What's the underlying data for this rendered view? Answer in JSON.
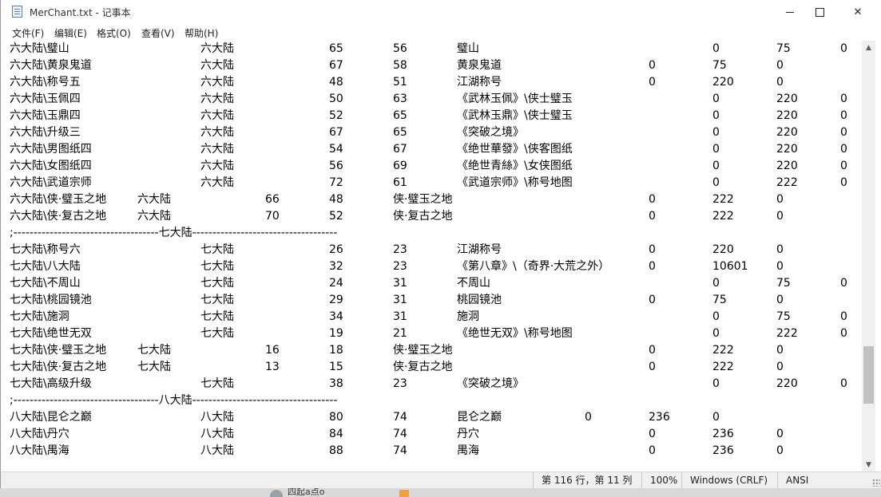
{
  "window": {
    "title": "MerChant.txt - 记事本",
    "icon": "notepad-icon",
    "controls": {
      "minimize": "minimize-icon",
      "maximize": "maximize-icon",
      "close": "✕"
    }
  },
  "menu": [
    "文件(F)",
    "编辑(E)",
    "格式(O)",
    "查看(V)",
    "帮助(H)"
  ],
  "lines": [
    [
      "六大陆\\璧山",
      "六大陆",
      "65",
      "56",
      "璧山",
      "",
      "0",
      "75",
      "0"
    ],
    [
      "六大陆\\黄泉鬼道",
      "六大陆",
      "67",
      "58",
      "黄泉鬼道",
      "0",
      "75",
      "0",
      ""
    ],
    [
      "六大陆\\称号五",
      "六大陆",
      "48",
      "51",
      "江湖称号",
      "0",
      "220",
      "0",
      ""
    ],
    [
      "六大陆\\玉佩四",
      "六大陆",
      "50",
      "63",
      "《武林玉佩》\\侠士璧玉",
      "",
      "0",
      "220",
      "0"
    ],
    [
      "六大陆\\玉鼎四",
      "六大陆",
      "52",
      "65",
      "《武林玉鼎》\\侠士璧玉",
      "",
      "0",
      "220",
      "0"
    ],
    [
      "六大陆\\升级三",
      "六大陆",
      "67",
      "65",
      "《突破之境》",
      "",
      "0",
      "220",
      "0"
    ],
    [
      "六大陆\\男图纸四",
      "六大陆",
      "54",
      "67",
      "《绝世華發》\\侠客图纸",
      "",
      "0",
      "220",
      "0"
    ],
    [
      "六大陆\\女图纸四",
      "六大陆",
      "56",
      "69",
      "《绝世青絲》\\女侠图纸",
      "",
      "0",
      "220",
      "0"
    ],
    [
      "六大陆\\武道宗师",
      "六大陆",
      "72",
      "61",
      "《武道宗师》\\称号地图",
      "",
      "0",
      "222",
      "0"
    ],
    [
      "六大陆\\侠·璧玉之地",
      "六大陆",
      "66",
      "48",
      "侠·璧玉之地",
      "0",
      "222",
      "0",
      ""
    ],
    [
      "六大陆\\侠·复古之地",
      "六大陆",
      "70",
      "52",
      "侠·复古之地",
      "0",
      "222",
      "0",
      ""
    ],
    [
      ";------------------------------------七大陆------------------------------------"
    ],
    [
      "七大陆\\称号六",
      "七大陆",
      "26",
      "23",
      "江湖称号",
      "0",
      "220",
      "0",
      ""
    ],
    [
      "七大陆\\八大陆",
      "七大陆",
      "32",
      "23",
      "《第八章》\\（奇界·大荒之外）",
      "0",
      "10601",
      "0",
      ""
    ],
    [
      "七大陆\\不周山",
      "七大陆",
      "24",
      "31",
      "不周山",
      "",
      "0",
      "75",
      "0"
    ],
    [
      "七大陆\\桃园镜池",
      "七大陆",
      "29",
      "31",
      "桃园镜池",
      "0",
      "75",
      "0",
      ""
    ],
    [
      "七大陆\\施洞",
      "七大陆",
      "34",
      "31",
      "施洞",
      "",
      "0",
      "75",
      "0"
    ],
    [
      "七大陆\\绝世无双",
      "七大陆",
      "19",
      "21",
      "《绝世无双》\\称号地图",
      "",
      "0",
      "222",
      "0"
    ],
    [
      "七大陆\\侠·璧玉之地",
      "七大陆",
      "16",
      "18",
      "侠·璧玉之地",
      "0",
      "222",
      "0",
      ""
    ],
    [
      "七大陆\\侠·复古之地",
      "七大陆",
      "13",
      "15",
      "侠·复古之地",
      "0",
      "222",
      "0",
      ""
    ],
    [
      "七大陆\\高级升级",
      "七大陆",
      "38",
      "23",
      "《突破之境》",
      "",
      "0",
      "220",
      "0"
    ],
    [
      ";------------------------------------八大陆------------------------------------"
    ],
    [
      "八大陆\\昆仑之巅",
      "八大陆",
      "80",
      "74",
      "昆仑之巅",
      "0",
      "236",
      "0",
      ""
    ],
    [
      "八大陆\\丹穴",
      "八大陆",
      "84",
      "74",
      "丹穴",
      "0",
      "236",
      "0",
      ""
    ],
    [
      "八大陆\\禺海",
      "八大陆",
      "88",
      "74",
      "禺海",
      "0",
      "236",
      "0",
      ""
    ]
  ],
  "status": {
    "position": "第 116 行，第 11 列",
    "zoom": "100%",
    "line_ending": "Windows (CRLF)",
    "encoding": "ANSI"
  },
  "desktop": {
    "taskbar_text": "四起a点o"
  }
}
